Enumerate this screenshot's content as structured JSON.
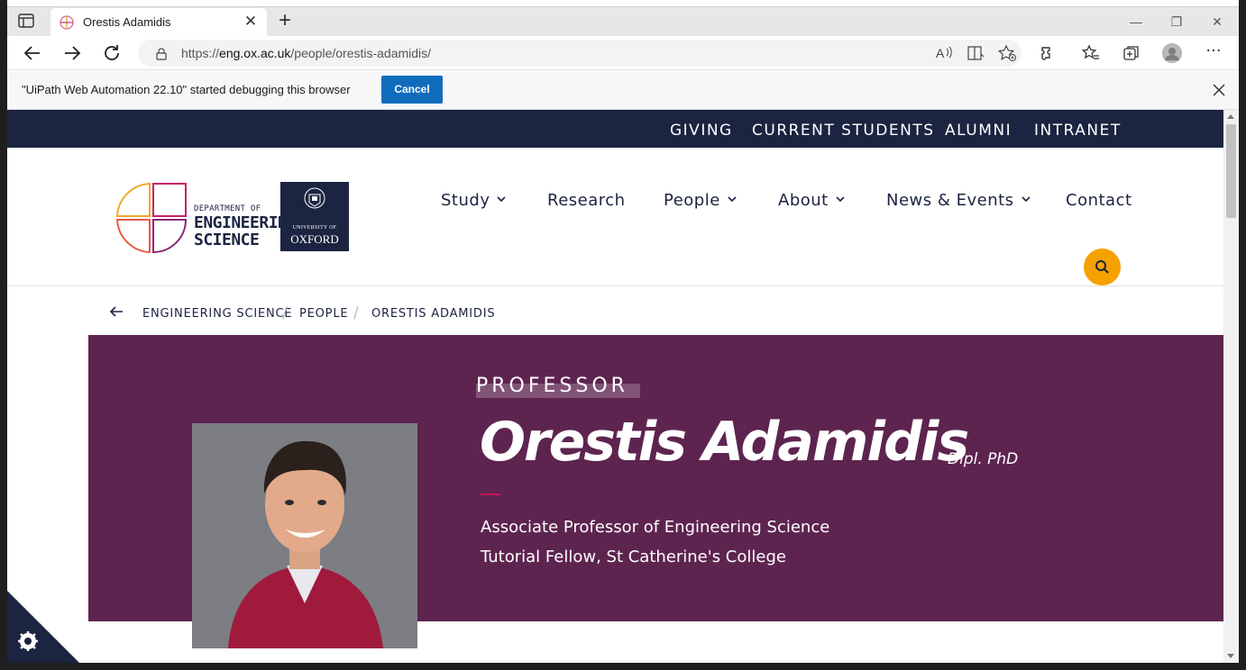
{
  "browser": {
    "tab_title": "Orestis Adamidis",
    "url_prefix": "https://",
    "url_host": "eng.ox.ac.uk",
    "url_path": "/people/orestis-adamidis/",
    "infobar_text": "\"UiPath Web Automation 22.10\" started debugging this browser",
    "infobar_cancel": "Cancel"
  },
  "utility_nav": [
    "GIVING",
    "CURRENT STUDENTS",
    "ALUMNI",
    "INTRANET"
  ],
  "logo": {
    "line1": "DEPARTMENT OF",
    "line2": "ENGINEERING",
    "line3": "SCIENCE",
    "oxford_line1": "UNIVERSITY OF",
    "oxford_line2": "OXFORD"
  },
  "main_nav": [
    {
      "label": "Study",
      "dropdown": true
    },
    {
      "label": "Research",
      "dropdown": false
    },
    {
      "label": "People",
      "dropdown": true
    },
    {
      "label": "About",
      "dropdown": true
    },
    {
      "label": "News & Events",
      "dropdown": true
    },
    {
      "label": "Contact",
      "dropdown": false
    }
  ],
  "breadcrumb": [
    "ENGINEERING SCIENCE",
    "PEOPLE",
    "ORESTIS ADAMIDIS"
  ],
  "profile": {
    "title": "PROFESSOR",
    "name": "Orestis Adamidis",
    "postnominals": "Dipl. PhD",
    "role1": "Associate Professor of Engineering Science",
    "role2": "Tutorial Fellow, St Catherine's College"
  },
  "colors": {
    "navy": "#1b2440",
    "plum": "#5e2450",
    "orange": "#f5a100",
    "accent_pink": "#c4145a",
    "edge_blue": "#0f6cbd"
  },
  "icons": [
    "sidebar-icon",
    "favicon-icon",
    "close-icon",
    "plus-icon",
    "back-icon",
    "forward-icon",
    "refresh-icon",
    "lock-icon",
    "read-aloud-icon",
    "immersive-reader-icon",
    "favorite-add-icon",
    "extensions-icon",
    "favorites-icon",
    "collections-icon",
    "profile-icon",
    "more-icon",
    "search-icon",
    "cookie-settings-icon"
  ]
}
